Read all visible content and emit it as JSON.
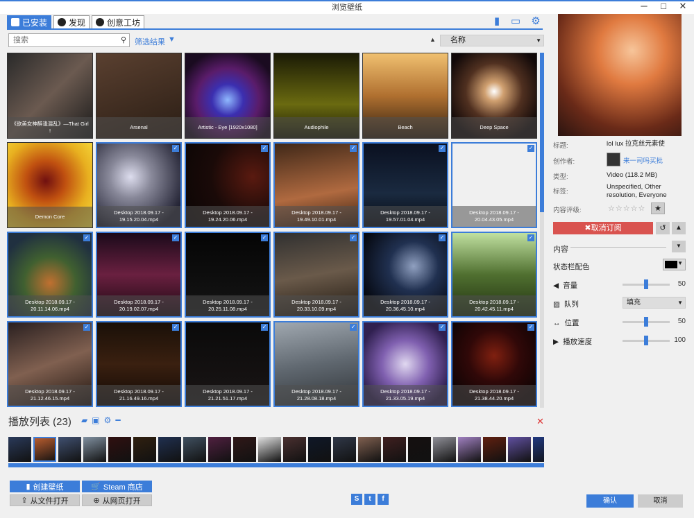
{
  "window": {
    "title": "浏览壁纸",
    "minimize": "─",
    "maximize": "□",
    "close": "✕"
  },
  "tabs": [
    {
      "label": "已安装",
      "icon": "save-icon"
    },
    {
      "label": "发现",
      "icon": "compass-icon"
    },
    {
      "label": "创意工坊",
      "icon": "steam-icon"
    }
  ],
  "top_icons": [
    "file-icon",
    "monitor-icon",
    "gear-icon"
  ],
  "search": {
    "placeholder": "搜索",
    "value": ""
  },
  "filter_label": "筛选结果",
  "sort": {
    "selected": "名称"
  },
  "wallpapers": [
    {
      "caption": "《欲美女神醉逢混乱》—That Girl !",
      "bg": "linear-gradient(135deg,#2a2a2a,#6b5a50 50,#1a1a1a)",
      "selected": false
    },
    {
      "caption": "Arsenal",
      "bg": "linear-gradient(160deg,#5a4030,#2a1d14)",
      "selected": false
    },
    {
      "caption": "Artistic - Eye [1920x1080]",
      "bg": "radial-gradient(circle at 50% 55%,#8fb8ff 0%,#3b2fb0 25%,#5a1c6a 50%,#1a0b20 80%)",
      "selected": false
    },
    {
      "caption": "Audiophile",
      "bg": "linear-gradient(180deg,#1a1a05,#6a6a10 60%,#1a1a05)",
      "selected": false
    },
    {
      "caption": "Beach",
      "bg": "linear-gradient(180deg,#f0c070,#b07030 50%,#302010)",
      "selected": false
    },
    {
      "caption": "Deep Space",
      "bg": "radial-gradient(circle at 50% 45%,#fff 0%,#d0a070 15%,#503020 45%,#100808 80%)",
      "selected": false
    },
    {
      "caption": "Demon Core",
      "bg": "radial-gradient(circle at 45% 45%,#701010 0%,#c05010 30%,#e8b020 65%,#f8e040 100%)",
      "selected": false
    },
    {
      "caption": "Desktop 2018.09.17 - 19.15.20.04.mp4",
      "bg": "radial-gradient(circle at 40% 40%,#dde 0%,#889 30%,#223 80%)",
      "selected": true
    },
    {
      "caption": "Desktop 2018.09.17 - 19.24.20.06.mp4",
      "bg": "radial-gradient(circle at 80% 40%,#5a1a10 0%,#1a0a08 50%,#0a0505 100%)",
      "selected": true
    },
    {
      "caption": "Desktop 2018.09.17 - 19.49.10.01.mp4",
      "bg": "linear-gradient(170deg,#402818,#b06a40 60%,#3a2010)",
      "selected": true
    },
    {
      "caption": "Desktop 2018.09.17 - 19.57.01.04.mp4",
      "bg": "linear-gradient(180deg,#0a1020,#1a2a40 60%,#050810)",
      "selected": true
    },
    {
      "caption": "Desktop 2018.09.17 - 20.04.43.05.mp4",
      "bg": "linear-gradient(180deg,#2a3550,#5a6a90 50%,#202838)",
      "selected": true
    },
    {
      "caption": "Desktop 2018.09.17 - 20.11.14.06.mp4",
      "bg": "radial-gradient(circle at 50% 60%,#c07030 0%,#406030 40%,#203040 80%)",
      "selected": true
    },
    {
      "caption": "Desktop 2018.09.17 - 20.19.02.07.mp4",
      "bg": "linear-gradient(180deg,#1a0a1a,#6a2040 50%,#1a0810)",
      "selected": true
    },
    {
      "caption": "Desktop 2018.09.17 - 20.25.11.08.mp4",
      "bg": "linear-gradient(180deg,#050505,#151515)",
      "selected": true
    },
    {
      "caption": "Desktop 2018.09.17 - 20.33.10.09.mp4",
      "bg": "linear-gradient(170deg,#303030,#6a5a4a 50%,#201810)",
      "selected": true
    },
    {
      "caption": "Desktop 2018.09.17 - 20.36.45.10.mp4",
      "bg": "radial-gradient(circle at 60% 40%,#90a0c0 0%,#203050 35%,#050810 80%)",
      "selected": true
    },
    {
      "caption": "Desktop 2018.09.17 - 20.42.45.11.mp4",
      "bg": "linear-gradient(180deg,#c0e0a0,#507030 50%,#203010)",
      "selected": true
    },
    {
      "caption": "Desktop 2018.09.17 - 21.12.46.15.mp4",
      "bg": "linear-gradient(160deg,#2a2020,#806050 50%,#201510)",
      "selected": true
    },
    {
      "caption": "Desktop 2018.09.17 - 21.16.49.16.mp4",
      "bg": "linear-gradient(180deg,#1a1008,#3a2010 50%,#100804)",
      "selected": true
    },
    {
      "caption": "Desktop 2018.09.17 - 21.21.51.17.mp4",
      "bg": "linear-gradient(180deg,#0a0a0a,#1a1515)",
      "selected": true
    },
    {
      "caption": "Desktop 2018.09.17 - 21.28.08.18.mp4",
      "bg": "linear-gradient(170deg,#a0a8b0,#606870 50%,#303438)",
      "selected": true
    },
    {
      "caption": "Desktop 2018.09.17 - 21.33.05.19.mp4",
      "bg": "radial-gradient(circle at 50% 50%,#e0d8f0 0%,#8060b0 40%,#302050 80%)",
      "selected": true
    },
    {
      "caption": "Desktop 2018.09.17 - 21.38.44.20.mp4",
      "bg": "radial-gradient(circle at 50% 40%,#802010 0%,#300808 40%,#100404 80%)",
      "selected": true
    }
  ],
  "playlist": {
    "title": "播放列表 (23)",
    "icons": [
      "folder-icon",
      "save-icon",
      "gears-icon",
      "minus-icon"
    ],
    "close_icon": "close-icon",
    "thumbs": [
      "#2a3a5a",
      "#c06030",
      "#405070",
      "#8090a0",
      "#301010",
      "#302010",
      "#203050",
      "#405060",
      "#502040",
      "#301818",
      "#e0e0e0",
      "#4a3030",
      "#101828",
      "#303848",
      "#806050",
      "#402020",
      "#151010",
      "#909098",
      "#a080c0",
      "#602010",
      "#6050a0",
      "#203880"
    ]
  },
  "buttons": {
    "create": "创建壁纸",
    "steam": "Steam 商店",
    "open_file": "从文件打开",
    "open_web": "从网页打开"
  },
  "social": [
    "steam-icon",
    "twitter-icon",
    "facebook-icon"
  ],
  "details": {
    "title_label": "标题:",
    "title": "lol lux 拉克丝元素使",
    "creator_label": "创作者:",
    "creator": "来一司吗买批",
    "type_label": "类型:",
    "type": "Video (118.2 MB)",
    "tags_label": "标签:",
    "tags": "Unspecified, Other resolution, Everyone",
    "rating_label": "内容评级:",
    "stars": "☆☆☆☆☆",
    "unsubscribe": "✖取消订阅",
    "content": "内容",
    "statusbar_color": "状态栏配色",
    "volume_label": "音量",
    "volume": "50",
    "queue_label": "队列",
    "queue_value": "填充",
    "position_label": "位置",
    "position": "50",
    "speed_label": "播放速度",
    "speed": "100",
    "ok": "确认",
    "cancel": "取消"
  },
  "colors": {
    "accent": "#3c7dd9",
    "danger": "#d9534f"
  }
}
